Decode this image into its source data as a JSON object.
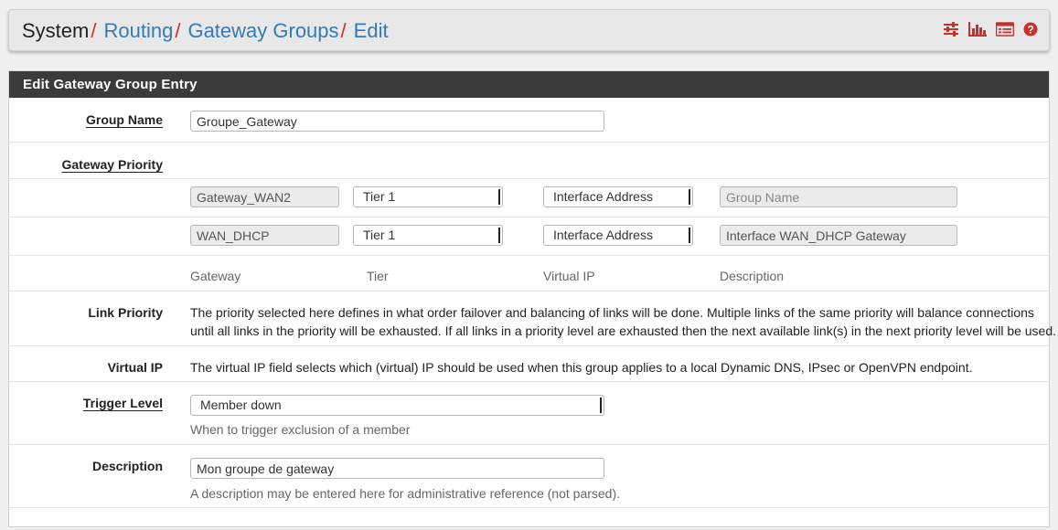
{
  "breadcrumb": {
    "items": [
      "System",
      "Routing",
      "Gateway Groups",
      "Edit"
    ],
    "separator": "/"
  },
  "header_icons": [
    "sliders-icon",
    "bar-chart-icon",
    "list-icon",
    "help-icon"
  ],
  "panel": {
    "title": "Edit Gateway Group Entry"
  },
  "group_name": {
    "label": "Group Name",
    "value": "Groupe_Gateway"
  },
  "gateway_priority": {
    "label": "Gateway Priority",
    "rows": [
      {
        "gateway": "Gateway_WAN2",
        "tier": "Tier 1",
        "virtual_ip": "Interface Address",
        "description": "",
        "description_placeholder": "Group Name"
      },
      {
        "gateway": "WAN_DHCP",
        "tier": "Tier 1",
        "virtual_ip": "Interface Address",
        "description": "Interface WAN_DHCP Gateway",
        "description_placeholder": ""
      }
    ],
    "columns": [
      "Gateway",
      "Tier",
      "Virtual IP",
      "Description"
    ]
  },
  "link_priority": {
    "label": "Link Priority",
    "text_line1": "The priority selected here defines in what order failover and balancing of links will be done. Multiple links of the same priority will balance connections",
    "text_line2": "until all links in the priority will be exhausted. If all links in a priority level are exhausted then the next available link(s) in the next priority level will be used."
  },
  "virtual_ip": {
    "label": "Virtual IP",
    "text": "The virtual IP field selects which (virtual) IP should be used when this group applies to a local Dynamic DNS, IPsec or OpenVPN endpoint."
  },
  "trigger_level": {
    "label": "Trigger Level",
    "value": "Member down",
    "help": "When to trigger exclusion of a member"
  },
  "description": {
    "label": "Description",
    "value": "Mon groupe de gateway",
    "help": "A description may be entered here for administrative reference (not parsed)."
  },
  "colors": {
    "link": "#337ab7",
    "separator": "#c9302c",
    "icon": "#c9302c",
    "panel_heading": "#3b3b3b"
  }
}
